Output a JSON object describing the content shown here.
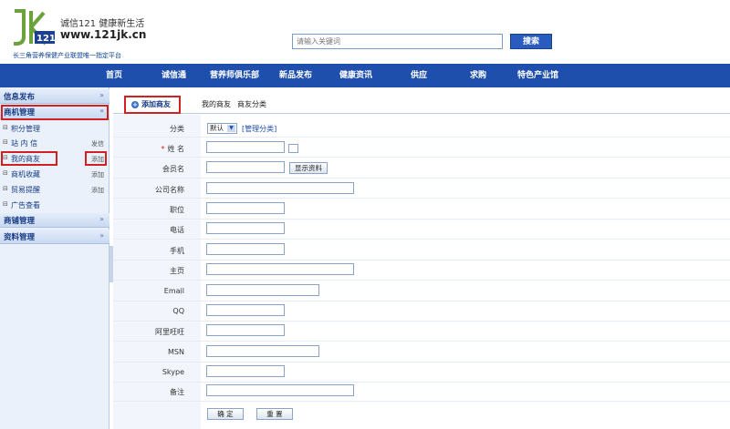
{
  "brand": {
    "logo_text": "诚信121 健康新生活",
    "domain": "www.121jk.cn",
    "tagline": "长三角营养保健产业联盟唯一指定平台"
  },
  "search": {
    "placeholder": "请输入关键词",
    "button": "搜索"
  },
  "nav": [
    "首页",
    "诚信通",
    "营养师俱乐部",
    "新品发布",
    "健康资讯",
    "供应",
    "求购",
    "特色产业馆"
  ],
  "sidebar": {
    "sections": [
      {
        "title": "信息发布",
        "chevron": "»"
      },
      {
        "title": "商机管理",
        "chevron": "«"
      },
      {
        "title": "商铺管理",
        "chevron": "»"
      },
      {
        "title": "资料管理",
        "chevron": "»"
      }
    ],
    "items": [
      {
        "label": "积分管理",
        "action": ""
      },
      {
        "label": "站 内 信",
        "action": "发信"
      },
      {
        "label": "我的商友",
        "action": "添加"
      },
      {
        "label": "商机收藏",
        "action": "添加"
      },
      {
        "label": "贸易提醒",
        "action": "添加"
      },
      {
        "label": "广告查看",
        "action": ""
      }
    ]
  },
  "tabs": [
    "添加商友",
    "我的商友",
    "商友分类"
  ],
  "form": {
    "category_label": "分类",
    "category_value": "默认",
    "manage_link": "[管理分类]",
    "name_label": "姓 名",
    "required_mark": "*",
    "member_label": "会员名",
    "show_profile": "显示资料",
    "company_label": "公司名称",
    "position_label": "职位",
    "phone_label": "电话",
    "mobile_label": "手机",
    "homepage_label": "主页",
    "email_label": "Email",
    "qq_label": "QQ",
    "aliwangwang_label": "阿里旺旺",
    "msn_label": "MSN",
    "skype_label": "Skype",
    "notes_label": "备注",
    "submit": "确 定",
    "reset": "重 置"
  },
  "colors": {
    "nav_bg": "#1f4fad",
    "highlight": "#d02020",
    "sidebar_bg": "#eaf1fb"
  }
}
